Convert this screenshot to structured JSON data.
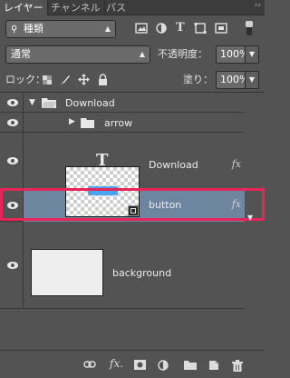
{
  "tabs": [
    {
      "label": "レイヤー",
      "active": true
    },
    {
      "label": "チャンネル",
      "active": false
    },
    {
      "label": "パス",
      "active": false
    }
  ],
  "panel_menu_icon": "collapse-arrows-icon",
  "filter": {
    "search_icon": "search-icon",
    "kind_label": "種類",
    "filter_icons": [
      "image-filter-icon",
      "adjustment-filter-icon",
      "type-filter-icon",
      "shape-filter-icon",
      "smart-object-filter-icon"
    ]
  },
  "blend": {
    "mode": "通常",
    "opacity_label": "不透明度：",
    "opacity_value": "100%"
  },
  "lock": {
    "label": "ロック：",
    "icons": [
      "lock-transparent-icon",
      "lock-image-icon",
      "lock-position-icon",
      "lock-all-icon"
    ],
    "fill_label": "塗り：",
    "fill_value": "100%"
  },
  "layers": [
    {
      "name": "Download",
      "type": "group",
      "expanded": true
    },
    {
      "name": "arrow",
      "type": "group",
      "expanded": false
    },
    {
      "name": "Download",
      "type": "text",
      "fx": "fx"
    },
    {
      "name": "button",
      "type": "shape",
      "fx": "fx",
      "selected": true
    },
    {
      "name": "background",
      "type": "pixel"
    }
  ],
  "bottom_icons": [
    "link-icon",
    "fx-icon",
    "mask-icon",
    "adjustment-icon",
    "folder-icon",
    "new-layer-icon",
    "trash-icon"
  ],
  "colors": {
    "panel_bg": "#535353",
    "selected_row": "#6e85a0",
    "highlight": "#e8245a",
    "shape_fill": "#4aa3f0"
  }
}
